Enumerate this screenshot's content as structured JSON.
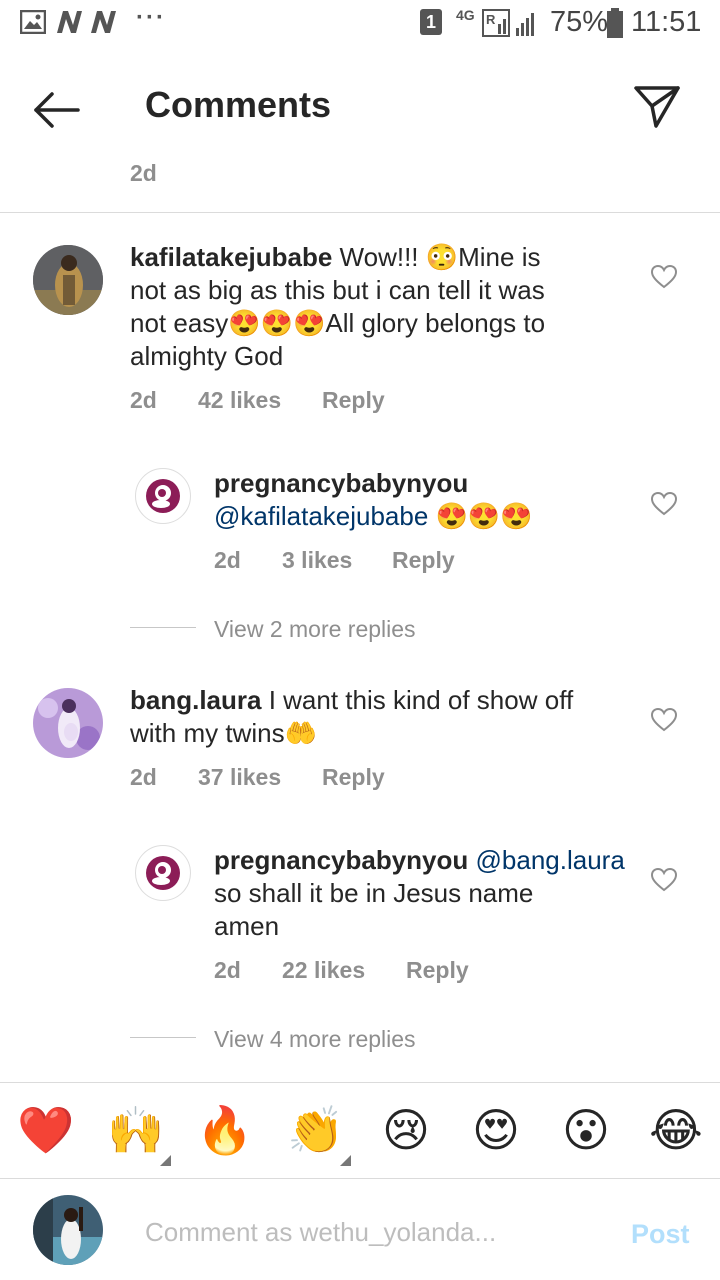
{
  "status_bar": {
    "sim_badge": "1",
    "network": "4G",
    "battery": "75%",
    "time": "11:51"
  },
  "header": {
    "title": "Comments"
  },
  "top_timestamp": "2d",
  "comments": [
    {
      "username": "kafilatakejubabe",
      "text_1": " Wow!!! 😳Mine is",
      "text_2": "not as big as this but i can tell it was",
      "text_3": "not easy😍😍😍All glory belongs to",
      "text_4": "almighty God",
      "time": "2d",
      "likes": "42 likes",
      "reply": "Reply"
    },
    {
      "username": "bang.laura",
      "text_1": " I want this kind of show off",
      "text_2": "with my twins🤲",
      "time": "2d",
      "likes": "37 likes",
      "reply": "Reply"
    }
  ],
  "replies": [
    {
      "username": "pregnancybabynyou",
      "mention": "@kafilatakejubabe",
      "emoji": " 😍😍😍",
      "time": "2d",
      "likes": "3 likes",
      "reply": "Reply"
    },
    {
      "username": "pregnancybabynyou",
      "mention": "@bang.laura",
      "text_2": "so shall it be in Jesus name",
      "text_3": "amen",
      "time": "2d",
      "likes": "22 likes",
      "reply": "Reply"
    }
  ],
  "view_more": [
    "View 2 more replies",
    "View 4 more replies"
  ],
  "emoji_bar": [
    "❤️",
    "🙌",
    "🔥",
    "👏",
    "😢",
    "😍",
    "😮",
    "😂"
  ],
  "composer": {
    "placeholder": "Comment as wethu_yolanda...",
    "post": "Post"
  },
  "colors": {
    "mention": "#003569",
    "meta": "#8e8e8e",
    "post_disabled": "#b2dffc"
  }
}
